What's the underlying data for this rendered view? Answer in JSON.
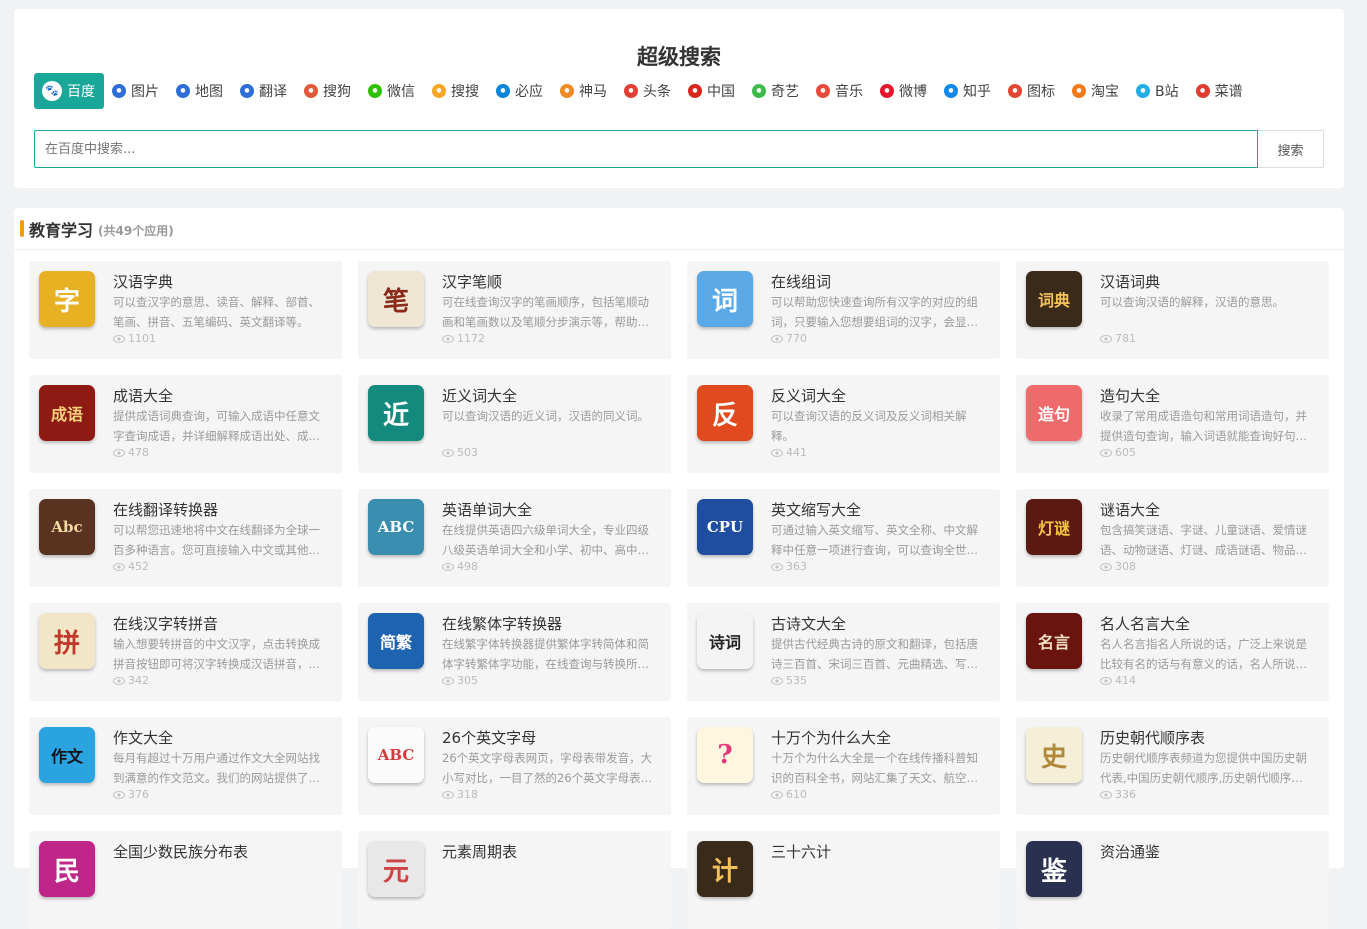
{
  "search": {
    "title": "超级搜索",
    "placeholder": "在百度中搜索...",
    "button_label": "搜索",
    "engines": [
      {
        "label": "百度",
        "icon": "baidu-paw-icon",
        "color": "#2f6dd6",
        "active": true
      },
      {
        "label": "图片",
        "icon": "baidu-paw-icon",
        "color": "#2f6dd6"
      },
      {
        "label": "地图",
        "icon": "baidu-paw-icon",
        "color": "#2f6dd6"
      },
      {
        "label": "翻译",
        "icon": "baidu-paw-icon",
        "color": "#2f6dd6"
      },
      {
        "label": "搜狗",
        "icon": "sogou-icon",
        "color": "#e0593b"
      },
      {
        "label": "微信",
        "icon": "wechat-icon",
        "color": "#2dc100"
      },
      {
        "label": "搜搜",
        "icon": "soso-icon",
        "color": "#f5a623"
      },
      {
        "label": "必应",
        "icon": "bing-icon",
        "color": "#0a84d8"
      },
      {
        "label": "神马",
        "icon": "shenma-icon",
        "color": "#f08a24"
      },
      {
        "label": "头条",
        "icon": "toutiao-icon",
        "color": "#e33e33"
      },
      {
        "label": "中国",
        "icon": "chinaso-icon",
        "color": "#d8261b"
      },
      {
        "label": "奇艺",
        "icon": "iqiyi-icon",
        "color": "#3dbb4a"
      },
      {
        "label": "音乐",
        "icon": "music-icon",
        "color": "#e84a3a"
      },
      {
        "label": "微博",
        "icon": "weibo-icon",
        "color": "#e6162d"
      },
      {
        "label": "知乎",
        "icon": "zhihu-icon",
        "color": "#0f88eb"
      },
      {
        "label": "图标",
        "icon": "iconfont-icon",
        "color": "#e2452f"
      },
      {
        "label": "淘宝",
        "icon": "taobao-icon",
        "color": "#f27a1a"
      },
      {
        "label": "B站",
        "icon": "bilibili-icon",
        "color": "#23ade5"
      },
      {
        "label": "菜谱",
        "icon": "recipe-icon",
        "color": "#e03c31"
      }
    ]
  },
  "panel": {
    "title": "教育学习",
    "count": "(共49个应用)",
    "apps": [
      {
        "name": "汉语字典",
        "desc": "可以查汉字的意思、读音、解释、部首、笔画、拼音、五笔编码、英文翻译等。",
        "views": "1101",
        "icon": "dictionary-book-icon",
        "glyph": "字",
        "bg": "#e8b023",
        "fg": "#fff"
      },
      {
        "name": "汉字笔顺",
        "desc": "可在线查询汉字的笔画顺序，包括笔顺动画和笔画数以及笔顺分步演示等，帮助…",
        "views": "1172",
        "icon": "brush-stroke-icon",
        "glyph": "笔",
        "bg": "#efe6d4",
        "fg": "#8b2a1a"
      },
      {
        "name": "在线组词",
        "desc": "可以帮助您快速查询所有汉字的对应的组词，只要输入您想要组词的汉字，会显…",
        "views": "770",
        "icon": "graduation-cap-icon",
        "glyph": "词",
        "bg": "#5aa9e6",
        "fg": "#fff"
      },
      {
        "name": "汉语词典",
        "desc": "可以查询汉语的解释，汉语的意思。",
        "views": "781",
        "icon": "chinese-dictionary-icon",
        "glyph": "词典",
        "bg": "#3a2a1a",
        "fg": "#f2c15a"
      },
      {
        "name": "成语大全",
        "desc": "提供成语词典查询，可输入成语中任意文字查询成语，并详细解释成语出处、成…",
        "views": "478",
        "icon": "idiom-book-icon",
        "glyph": "成语",
        "bg": "#8e1a14",
        "fg": "#f4d27a"
      },
      {
        "name": "近义词大全",
        "desc": "可以查询汉语的近义词，汉语的同义词。",
        "views": "503",
        "icon": "synonym-icon",
        "glyph": "近",
        "bg": "#14897d",
        "fg": "#fff"
      },
      {
        "name": "反义词大全",
        "desc": "可以查询汉语的反义词及反义词相关解释。",
        "views": "441",
        "icon": "antonym-icon",
        "glyph": "反",
        "bg": "#e04a1e",
        "fg": "#fff"
      },
      {
        "name": "造句大全",
        "desc": "收录了常用成语造句和常用词语造句，并提供造句查询，输入词语就能查询好句…",
        "views": "605",
        "icon": "sentence-icon",
        "glyph": "造句",
        "bg": "#ef6a6a",
        "fg": "#fff"
      },
      {
        "name": "在线翻译转换器",
        "desc": "可以帮您迅速地将中文在线翻译为全球一百多种语言。您可直接输入中文或其他…",
        "views": "452",
        "icon": "translator-icon",
        "glyph": "Abc",
        "bg": "#5a3320",
        "fg": "#f0d9a0"
      },
      {
        "name": "英语单词大全",
        "desc": "在线提供英语四六级单词大全，专业四级八级英语单词大全和小学、初中、高中…",
        "views": "498",
        "icon": "abc-book-icon",
        "glyph": "ABC",
        "bg": "#3a8fb0",
        "fg": "#fff"
      },
      {
        "name": "英文缩写大全",
        "desc": "可通过输入英文缩写、英文全称、中文解释中任意一项进行查询，可以查询全世…",
        "views": "363",
        "icon": "cpu-abbreviation-icon",
        "glyph": "CPU",
        "bg": "#1f4ea1",
        "fg": "#fff"
      },
      {
        "name": "谜语大全",
        "desc": "包含搞笑谜语、字谜、儿童谜语、爱情谜语、动物谜语、灯谜、成语谜语、物品…",
        "views": "308",
        "icon": "lantern-riddle-icon",
        "glyph": "灯谜",
        "bg": "#5a1a12",
        "fg": "#f5c542"
      },
      {
        "name": "在线汉字转拼音",
        "desc": "输入想要转拼音的中文汉字，点击转换成拼音按钮即可将汉字转换成汉语拼音，…",
        "views": "342",
        "icon": "pinyin-bear-icon",
        "glyph": "拼",
        "bg": "#f2e6c8",
        "fg": "#c0392b"
      },
      {
        "name": "在线繁体字转换器",
        "desc": "在线繁字体转换器提供繁体字转简体和简体字转繁体字功能，在线查询与转换所…",
        "views": "305",
        "icon": "traditional-chinese-icon",
        "glyph": "简繁",
        "bg": "#1d63b0",
        "fg": "#fff"
      },
      {
        "name": "古诗文大全",
        "desc": "提供古代经典古诗的原文和翻译，包括唐诗三百首、宋词三百首、元曲精选、写…",
        "views": "535",
        "icon": "poetry-icon",
        "glyph": "诗词",
        "bg": "#f4f4f4",
        "fg": "#222"
      },
      {
        "name": "名人名言大全",
        "desc": "名人名言指名人所说的话，广泛上来说是比较有名的话与有意义的话，名人所说…",
        "views": "414",
        "icon": "famous-quotes-icon",
        "glyph": "名言",
        "bg": "#6a1410",
        "fg": "#f1e0c0"
      },
      {
        "name": "作文大全",
        "desc": "每月有超过十万用户通过作文大全网站找到满意的作文范文。我们的网站提供了…",
        "views": "376",
        "icon": "composition-icon",
        "glyph": "作文",
        "bg": "#2aa3e0",
        "fg": "#111"
      },
      {
        "name": "26个英文字母",
        "desc": "26个英文字母表网页，字母表带发音，大小写对比，一目了然的26个英文字母表…",
        "views": "318",
        "icon": "alphabet-icon",
        "glyph": "ABC",
        "bg": "#fbfbfb",
        "fg": "#d63a3a"
      },
      {
        "name": "十万个为什么大全",
        "desc": "十万个为什么大全是一个在线传播科普知识的百科全书，网站汇集了天文、航空…",
        "views": "610",
        "icon": "question-marks-icon",
        "glyph": "?",
        "bg": "#fff6e0",
        "fg": "#e23a7a"
      },
      {
        "name": "历史朝代顺序表",
        "desc": "历史朝代顺序表频道为您提供中国历史朝代表,中国历史朝代顺序,历史朝代顺序…",
        "views": "336",
        "icon": "bamboo-scroll-icon",
        "glyph": "史",
        "bg": "#f6efd8",
        "fg": "#b08a3a"
      },
      {
        "name": "全国少数民族分布表",
        "desc": "",
        "views": "",
        "icon": "ethnic-icon",
        "glyph": "民",
        "bg": "#c0268a",
        "fg": "#fff"
      },
      {
        "name": "元素周期表",
        "desc": "",
        "views": "",
        "icon": "periodic-table-icon",
        "glyph": "元",
        "bg": "#e8e8e8",
        "fg": "#c44"
      },
      {
        "name": "三十六计",
        "desc": "",
        "views": "",
        "icon": "strategy-icon",
        "glyph": "计",
        "bg": "#3a2a1a",
        "fg": "#f2c15a"
      },
      {
        "name": "资治通鉴",
        "desc": "",
        "views": "",
        "icon": "history-book-icon",
        "glyph": "鉴",
        "bg": "#2a3050",
        "fg": "#fff"
      }
    ]
  }
}
